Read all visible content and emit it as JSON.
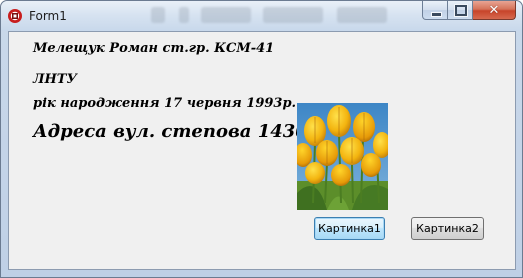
{
  "window": {
    "title": "Form1",
    "app_icon": "delphi-icon",
    "buttons": {
      "minimize": "minimize-icon",
      "maximize": "maximize-icon",
      "close_glyph": "✕"
    }
  },
  "labels": {
    "name": "Мелещук Роман ст.гр. КСМ-41",
    "university": "ЛНТУ",
    "birth": "рік народження 17 червня 1993р.",
    "address": "Адреса вул. степова 143б"
  },
  "picture": {
    "image": "tulips-image"
  },
  "actions": {
    "button1_label": "Картинка1",
    "button2_label": "Картинка2"
  },
  "colors": {
    "client_bg": "#f0f0f0",
    "focus_button_border": "#3c7fb1",
    "close_button": "#c7442a"
  }
}
